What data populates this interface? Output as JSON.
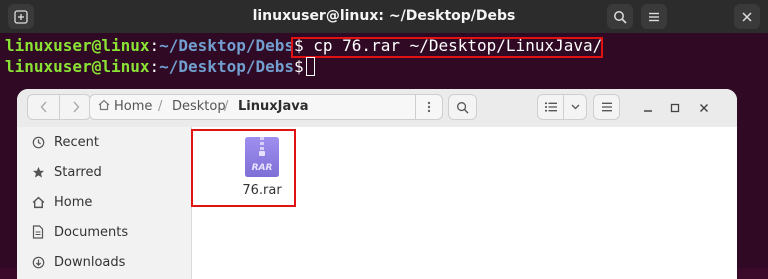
{
  "terminal": {
    "title": "linuxuser@linux: ~/Desktop/Debs",
    "lines": [
      {
        "user": "linuxuser@linux",
        "sep": ":",
        "path": "~/Desktop/Debs",
        "dollar": "$ ",
        "command": "cp 76.rar ~/Desktop/LinuxJava/"
      },
      {
        "user": "linuxuser@linux",
        "sep": ":",
        "path": "~/Desktop/Debs",
        "dollar": "$ ",
        "command": ""
      }
    ],
    "icons": {
      "new_tab": "new-tab-icon",
      "search": "search-icon",
      "menu": "hamburger-menu-icon",
      "close": "close-icon"
    },
    "colors": {
      "background": "#300a24",
      "prompt_user": "#8ae234",
      "prompt_path": "#729fcf",
      "highlight": "#e01212"
    }
  },
  "files": {
    "breadcrumb": [
      {
        "label": "Home",
        "icon": "home-icon"
      },
      {
        "label": "Desktop"
      },
      {
        "label": "LinuxJava"
      }
    ],
    "sidebar": [
      {
        "label": "Recent",
        "icon": "clock-icon"
      },
      {
        "label": "Starred",
        "icon": "star-icon"
      },
      {
        "label": "Home",
        "icon": "home-icon"
      },
      {
        "label": "Documents",
        "icon": "document-icon"
      },
      {
        "label": "Downloads",
        "icon": "download-icon"
      }
    ],
    "items": [
      {
        "name": "76.rar",
        "icon_text": "RAR",
        "icon": "rar-archive-icon"
      }
    ],
    "colors": {
      "archive_icon": "#8f7fe0"
    }
  }
}
